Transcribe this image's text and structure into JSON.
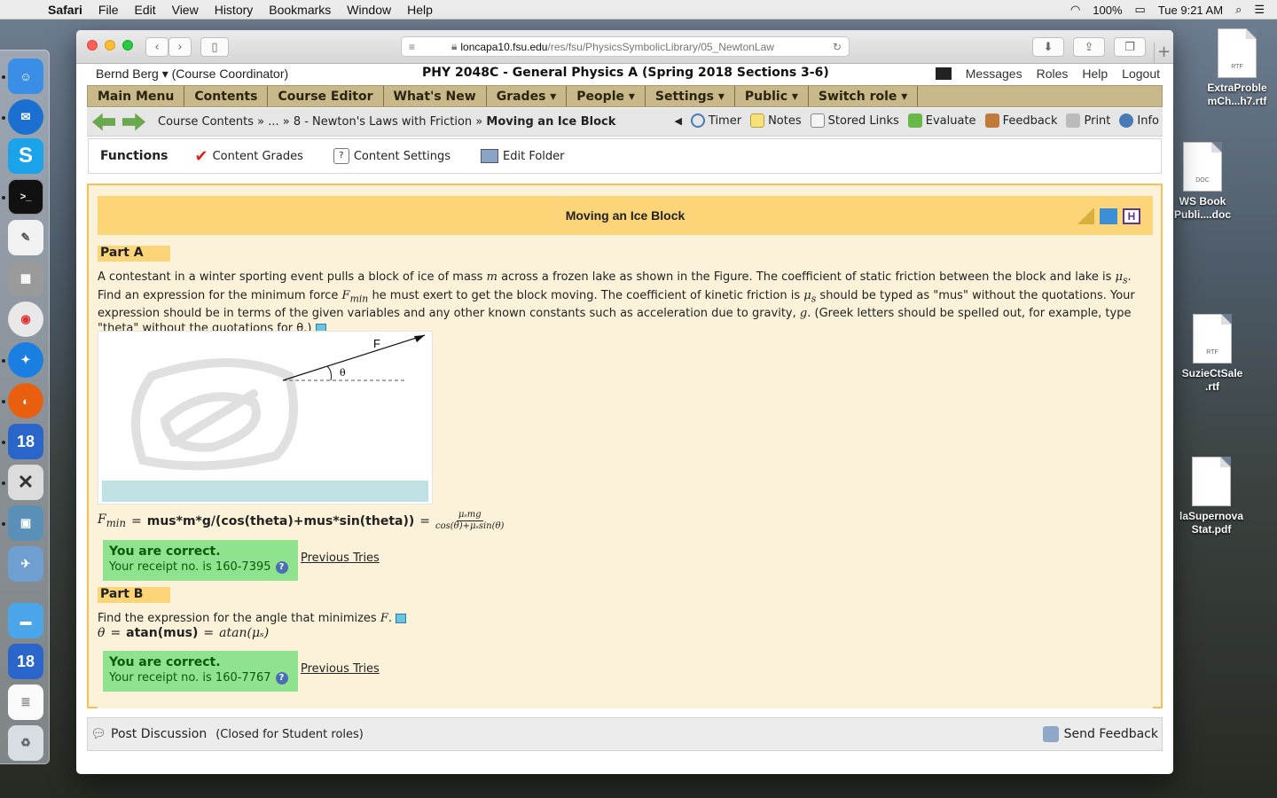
{
  "menubar": {
    "app": "Safari",
    "items": [
      "File",
      "Edit",
      "View",
      "History",
      "Bookmarks",
      "Window",
      "Help"
    ],
    "battery": "100%",
    "clock": "Tue 9:21 AM"
  },
  "desktop": {
    "files": [
      {
        "name": "ExtraProble mCh...h7.rtf",
        "type": "RTF"
      },
      {
        "name": "WS Book Publi....doc",
        "type": "DOC"
      },
      {
        "name": "SuzieCtSale .rtf",
        "type": "RTF"
      },
      {
        "name": "laSupernova Stat.pdf",
        "type": ""
      }
    ]
  },
  "browser": {
    "url_host": "loncapa10.fsu.edu",
    "url_path": "/res/fsu/PhysicsSymbolicLibrary/05_NewtonLaw"
  },
  "header": {
    "user": "Bernd Berg ▾",
    "role": "(Course Coordinator)",
    "course": "PHY 2048C - General Physics A (Spring 2018 Sections 3-6)",
    "links": [
      "Messages",
      "Roles",
      "Help",
      "Logout"
    ]
  },
  "nav": {
    "items": [
      "Main Menu",
      "Contents",
      "Course Editor",
      "What's New",
      "Grades ▾",
      "People ▾",
      "Settings ▾",
      "Public ▾",
      "Switch role ▾"
    ]
  },
  "breadcrumb": {
    "path": "Course Contents » ... » 8 - Newton's Laws with Friction »",
    "current": "Moving an Ice Block",
    "tools": [
      "Timer",
      "Notes",
      "Stored Links",
      "Evaluate",
      "Feedback",
      "Print",
      "Info"
    ]
  },
  "functions": {
    "heading": "Functions",
    "items": [
      "Content Grades",
      "Content Settings",
      "Edit Folder"
    ]
  },
  "problem": {
    "title": "Moving an Ice Block",
    "partA": {
      "label": "Part A",
      "text1": "A contestant in a winter sporting event pulls a block of ice of mass",
      "text2": "across a frozen lake as shown in the Figure. The coefficient of static friction between the block and lake is",
      "text3": "Find an expression for the minimum force",
      "text4": "he must exert to get the block moving. The coefficient of kinetic friction is",
      "text5": "should be typed as \"mus\" without the quotations. Your expression should be in terms of the given variables and any other known constants such as acceleration due to gravity,",
      "text6": ". (Greek letters should be spelled out, for example, type \"theta\" without the quotations for θ.)",
      "figure_force_label": "F",
      "figure_angle_label": "θ",
      "answer_lhs": "F",
      "answer_sub": "min",
      "answer": "mus*m*g/(cos(theta)+mus*sin(theta))",
      "rendered_num": "μₛmg",
      "rendered_den": "cos(θ)+μₛsin(θ)",
      "status": "You are correct.",
      "receipt": "Your receipt no. is 160-7395",
      "prev": "Previous Tries"
    },
    "partB": {
      "label": "Part B",
      "text": "Find the expression for the angle that minimizes",
      "answer_lhs": "θ",
      "answer": "atan(mus)",
      "rendered": "atan(μₛ)",
      "status": "You are correct.",
      "receipt": "Your receipt no. is 160-7767",
      "prev": "Previous Tries"
    }
  },
  "footer": {
    "post": "Post Discussion",
    "closed": "(Closed for Student roles)",
    "send": "Send Feedback"
  },
  "colors": {
    "nav_bg": "#c9b98a",
    "title_bg": "#fcd579",
    "content_bg": "#fcf2d9",
    "correct_bg": "#8fe38f"
  }
}
